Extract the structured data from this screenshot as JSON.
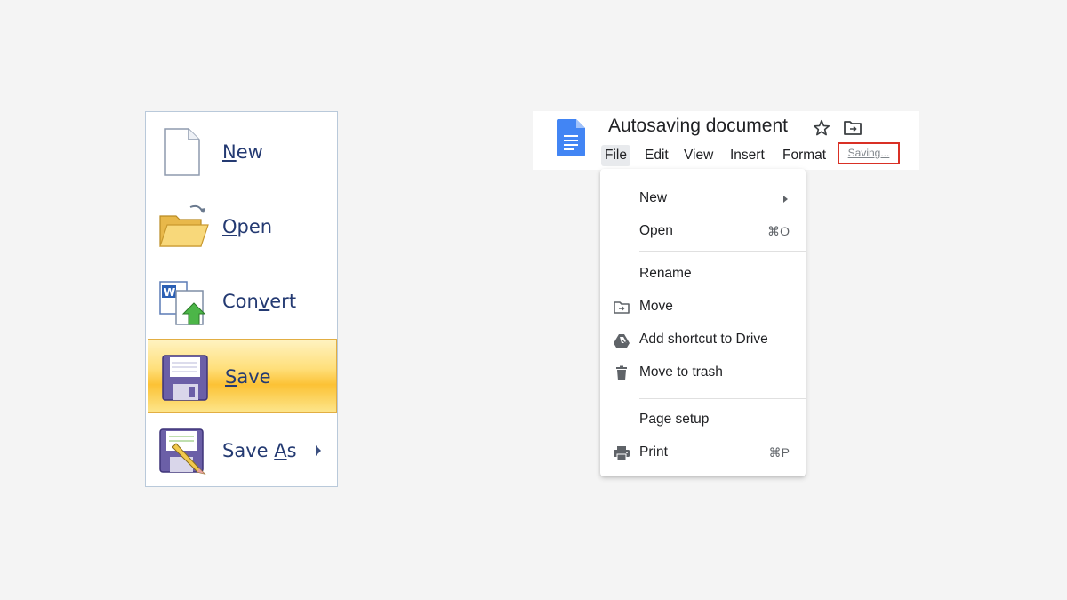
{
  "office_menu": {
    "items": [
      {
        "label": "New",
        "accel_index": 0,
        "icon": "new-document-icon",
        "selected": false,
        "has_submenu": false
      },
      {
        "label": "Open",
        "accel_index": 0,
        "icon": "open-folder-icon",
        "selected": false,
        "has_submenu": false
      },
      {
        "label": "Convert",
        "accel_index": 3,
        "icon": "convert-document-icon",
        "selected": false,
        "has_submenu": false
      },
      {
        "label": "Save",
        "accel_index": 0,
        "icon": "floppy-disk-icon",
        "selected": true,
        "has_submenu": false
      },
      {
        "label": "Save As",
        "accel_index": 5,
        "icon": "save-as-icon",
        "selected": false,
        "has_submenu": true
      }
    ],
    "colors": {
      "highlight": "#fcc235",
      "text": "#243a72",
      "border": "#b9c9da"
    }
  },
  "google_docs": {
    "title": "Autosaving document",
    "menu": [
      "File",
      "Edit",
      "View",
      "Insert",
      "Format"
    ],
    "active_menu": "File",
    "save_status": "Saving...",
    "file_menu": {
      "items": [
        {
          "label": "New",
          "shortcut": "",
          "icon": "",
          "submenu": true
        },
        {
          "label": "Open",
          "shortcut": "⌘O",
          "icon": "",
          "submenu": false
        },
        {
          "label": "Rename",
          "shortcut": "",
          "icon": "",
          "submenu": false
        },
        {
          "label": "Move",
          "shortcut": "",
          "icon": "move-folder-icon",
          "submenu": false
        },
        {
          "label": "Add shortcut to Drive",
          "shortcut": "",
          "icon": "drive-shortcut-icon",
          "submenu": false
        },
        {
          "label": "Move to trash",
          "shortcut": "",
          "icon": "trash-icon",
          "submenu": false
        },
        {
          "label": "Page setup",
          "shortcut": "",
          "icon": "",
          "submenu": false
        },
        {
          "label": "Print",
          "shortcut": "⌘P",
          "icon": "printer-icon",
          "submenu": false
        }
      ]
    },
    "colors": {
      "docs_blue": "#4285f4",
      "status_border": "#d93025",
      "status_text": "#80868b"
    }
  }
}
